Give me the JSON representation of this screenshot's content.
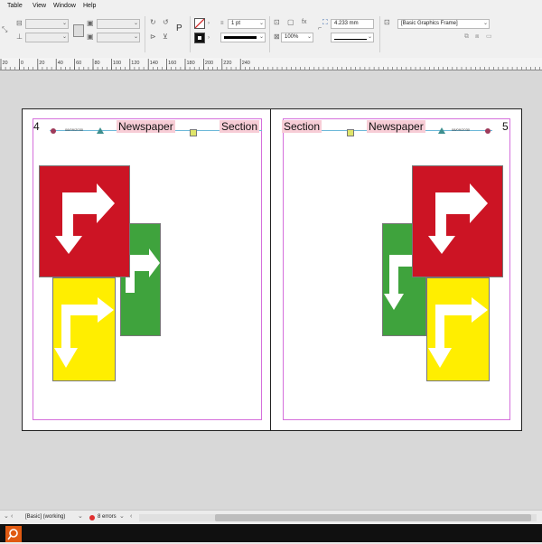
{
  "menu": {
    "items": [
      "Table",
      "View",
      "Window",
      "Help"
    ]
  },
  "control": {
    "stroke_weight": "1 pt",
    "scale": "100%",
    "dimension": "4.233 mm",
    "object_style": "[Basic Graphics Frame]",
    "text_frame_glyph": "P",
    "fx_glyph": "fx"
  },
  "ruler": {
    "labels": [
      "20",
      "0",
      "20",
      "40",
      "60",
      "80",
      "100",
      "120",
      "140",
      "160",
      "180",
      "200",
      "220",
      "240"
    ]
  },
  "left_page": {
    "page_number": "4",
    "date": "08/09/2030",
    "title": "Newspaper",
    "section": "Section"
  },
  "right_page": {
    "page_number": "5",
    "date": "08/09/2030",
    "title": "Newspaper",
    "section": "Section"
  },
  "status": {
    "preflight_profile": "[Basic] (working)",
    "errors": "8 errors"
  },
  "colors": {
    "red": "#cc1424",
    "green": "#3fa33d",
    "yellow": "#ffee00",
    "margin": "#d56fdc",
    "pink": "#f7cdd6"
  }
}
